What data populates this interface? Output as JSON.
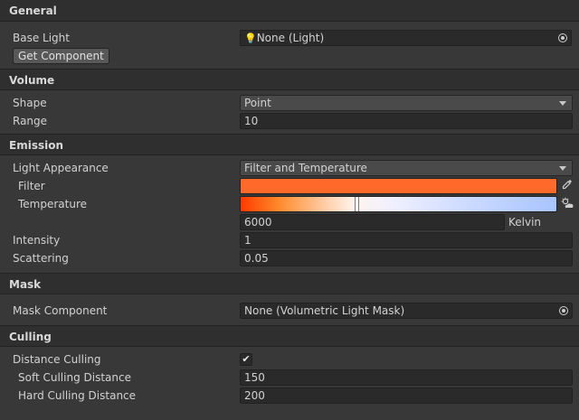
{
  "general": {
    "title": "General",
    "base_light_label": "Base Light",
    "base_light_value": "None (Light)",
    "get_component_label": "Get Component"
  },
  "volume": {
    "title": "Volume",
    "shape_label": "Shape",
    "shape_value": "Point",
    "range_label": "Range",
    "range_value": "10"
  },
  "emission": {
    "title": "Emission",
    "light_appearance_label": "Light Appearance",
    "light_appearance_value": "Filter and Temperature",
    "filter_label": "Filter",
    "filter_color": "#ff6a2a",
    "temperature_label": "Temperature",
    "temperature_value": "6000",
    "temperature_unit": "Kelvin",
    "temperature_fraction": 0.36,
    "intensity_label": "Intensity",
    "intensity_value": "1",
    "scattering_label": "Scattering",
    "scattering_value": "0.05"
  },
  "mask": {
    "title": "Mask",
    "mask_component_label": "Mask Component",
    "mask_component_value": "None (Volumetric Light Mask)"
  },
  "culling": {
    "title": "Culling",
    "distance_culling_label": "Distance Culling",
    "distance_culling_checked": true,
    "soft_culling_label": "Soft Culling Distance",
    "soft_culling_value": "150",
    "hard_culling_label": "Hard Culling Distance",
    "hard_culling_value": "200"
  },
  "icons": {
    "object_picker": "target-dot-icon",
    "bulb": "bulb-icon",
    "eyedropper": "eyedropper-icon",
    "weather": "sun-cloud-icon",
    "check": "checkmark-icon"
  }
}
